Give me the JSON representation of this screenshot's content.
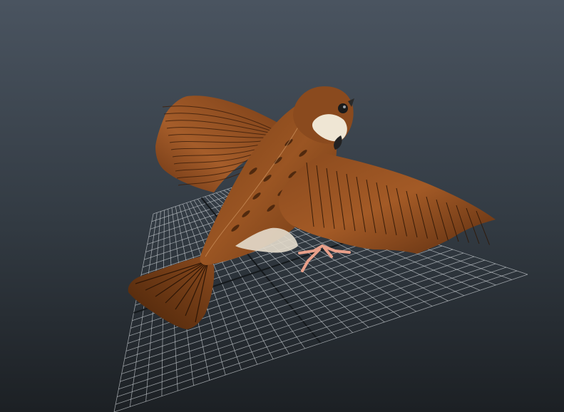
{
  "viewport": {
    "background_top_color": "#4a5460",
    "background_bottom_color": "#1c2024",
    "grid_line_color": "#c9ced2",
    "grid_axis_color": "#14181b"
  },
  "model": {
    "subject": "sparrow",
    "plumage_main_color": "#8a4a1e",
    "plumage_dark_color": "#3e1f0b",
    "plumage_light_color": "#c07a3c",
    "cheek_color": "#efe6d4",
    "feet_color": "#e9a08a"
  }
}
